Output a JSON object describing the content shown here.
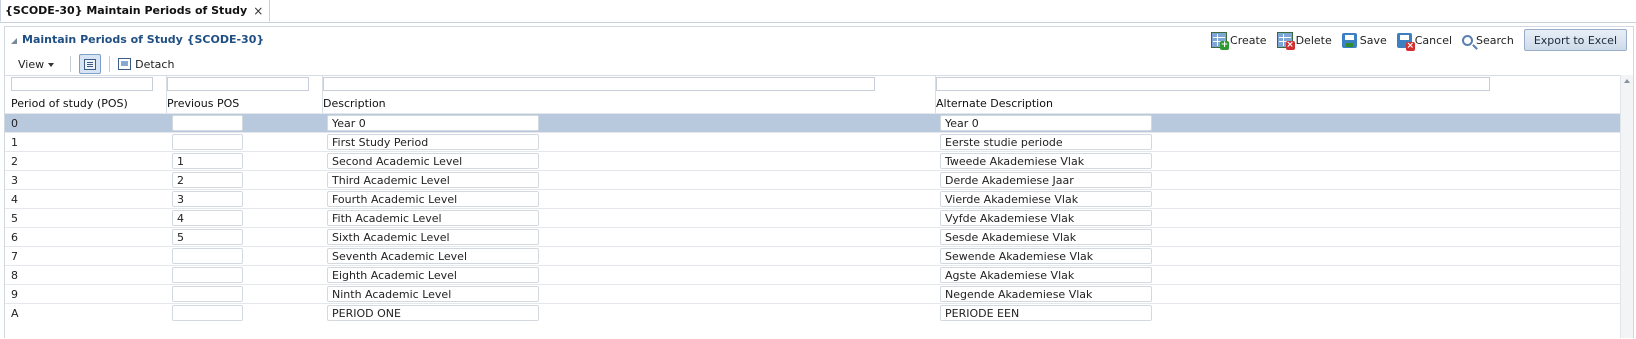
{
  "tab": {
    "title": "{SCODE-30} Maintain Periods of Study",
    "close": "×"
  },
  "panel": {
    "title": "Maintain Periods of Study {SCODE-30}"
  },
  "actions": {
    "create": "Create",
    "delete": "Delete",
    "save": "Save",
    "cancel": "Cancel",
    "search": "Search",
    "export": "Export to Excel"
  },
  "toolbar": {
    "view": "View",
    "detach": "Detach"
  },
  "columns": {
    "pos": "Period of study (POS)",
    "prev": "Previous POS",
    "desc": "Description",
    "alt": "Alternate Description"
  },
  "rows": [
    {
      "pos": "0",
      "prev": "",
      "desc": "Year 0",
      "alt": "Year 0"
    },
    {
      "pos": "1",
      "prev": "",
      "desc": "First Study Period",
      "alt": "Eerste studie periode"
    },
    {
      "pos": "2",
      "prev": "1",
      "desc": "Second Academic Level",
      "alt": "Tweede Akademiese Vlak"
    },
    {
      "pos": "3",
      "prev": "2",
      "desc": "Third Academic Level",
      "alt": "Derde Akademiese Jaar"
    },
    {
      "pos": "4",
      "prev": "3",
      "desc": "Fourth Academic Level",
      "alt": "Vierde Akademiese Vlak"
    },
    {
      "pos": "5",
      "prev": "4",
      "desc": "Fith Academic Level",
      "alt": "Vyfde Akademiese Vlak"
    },
    {
      "pos": "6",
      "prev": "5",
      "desc": "Sixth Academic Level",
      "alt": "Sesde Akademiese Vlak"
    },
    {
      "pos": "7",
      "prev": "",
      "desc": "Seventh Academic Level",
      "alt": "Sewende Akademiese Vlak"
    },
    {
      "pos": "8",
      "prev": "",
      "desc": "Eighth Academic Level",
      "alt": "Agste Akademiese Vlak"
    },
    {
      "pos": "9",
      "prev": "",
      "desc": "Ninth Academic Level",
      "alt": "Negende Akademiese Vlak"
    },
    {
      "pos": "A",
      "prev": "",
      "desc": "PERIOD ONE",
      "alt": "PERIODE EEN"
    }
  ],
  "selected_row": 0
}
